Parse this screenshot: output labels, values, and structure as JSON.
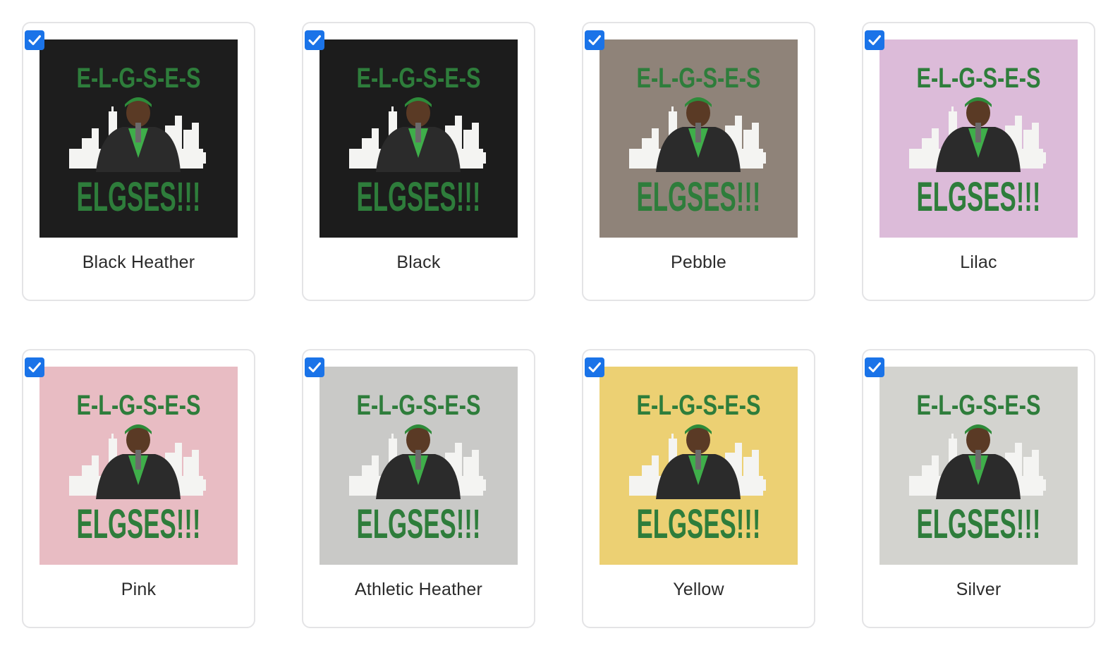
{
  "design": {
    "top_text": "E-L-G-S-E-S",
    "bottom_text": "ELGSES!!!",
    "ink_color": "#2e7d3b",
    "skyline_color": "#f4f4f2"
  },
  "variants": [
    {
      "label": "Black Heather",
      "bg": "#1d1d1d",
      "checked": true
    },
    {
      "label": "Black",
      "bg": "#1c1c1c",
      "checked": true
    },
    {
      "label": "Pebble",
      "bg": "#8f8379",
      "checked": true
    },
    {
      "label": "Lilac",
      "bg": "#dcbbd9",
      "checked": true
    },
    {
      "label": "Pink",
      "bg": "#e8bcc3",
      "checked": true
    },
    {
      "label": "Athletic Heather",
      "bg": "#c9c9c7",
      "checked": true
    },
    {
      "label": "Yellow",
      "bg": "#ecd073",
      "checked": true
    },
    {
      "label": "Silver",
      "bg": "#d3d3cf",
      "checked": true
    }
  ],
  "icons": {
    "checkbox": "checkmark-icon"
  },
  "accent": "#1a73e8"
}
